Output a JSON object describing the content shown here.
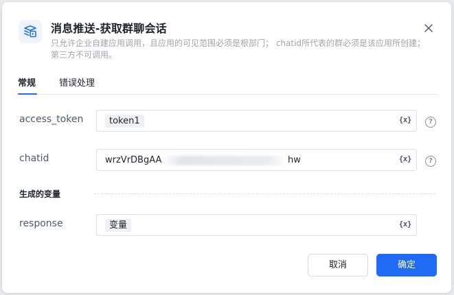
{
  "dialog": {
    "title": "消息推送-获取群聊会话",
    "description": "只允许企业自建应用调用，且应用的可见范围必须是根部门；  chatid所代表的群必须是该应用所创建；  第三方不可调用。"
  },
  "tabs": [
    {
      "label": "常规",
      "active": true
    },
    {
      "label": "错误处理",
      "active": false
    }
  ],
  "fields": {
    "access_token": {
      "label": "access_token",
      "value": "token1"
    },
    "chatid": {
      "label": "chatid",
      "value_start": "wrzVrDBgAA",
      "value_end": "hw",
      "value_redacted": true
    }
  },
  "output_section": {
    "title": "生成的变量",
    "response": {
      "label": "response",
      "value": "变量"
    }
  },
  "variable_button_label": "{x}",
  "help_icon_label": "?",
  "footer": {
    "cancel_label": "取消",
    "confirm_label": "确定"
  },
  "colors": {
    "accent": "#1f6bf6",
    "icon_bg": "#eef3ff"
  }
}
